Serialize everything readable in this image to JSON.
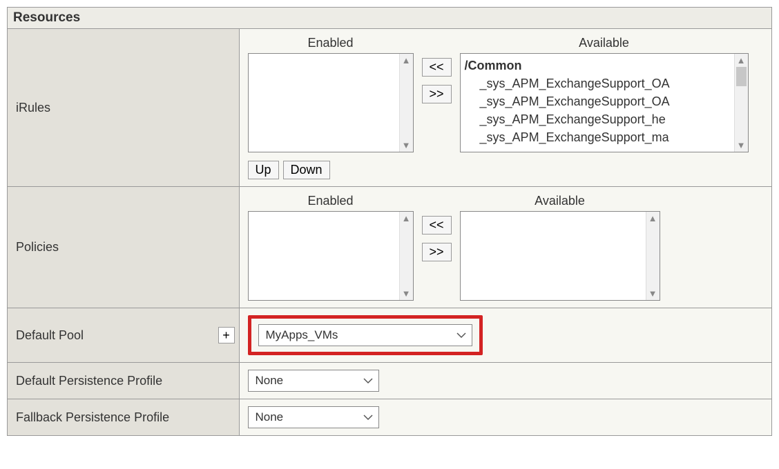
{
  "section_title": "Resources",
  "rows": {
    "irules": {
      "label": "iRules",
      "enabled_label": "Enabled",
      "available_label": "Available",
      "available_group": "/Common",
      "available_items": [
        "_sys_APM_ExchangeSupport_OA",
        "_sys_APM_ExchangeSupport_OA",
        "_sys_APM_ExchangeSupport_he",
        "_sys_APM_ExchangeSupport_ma"
      ],
      "move_left": "<<",
      "move_right": ">>",
      "up_label": "Up",
      "down_label": "Down"
    },
    "policies": {
      "label": "Policies",
      "enabled_label": "Enabled",
      "available_label": "Available",
      "move_left": "<<",
      "move_right": ">>"
    },
    "default_pool": {
      "label": "Default Pool",
      "plus": "+",
      "value": "MyApps_VMs"
    },
    "default_persistence": {
      "label": "Default Persistence Profile",
      "value": "None"
    },
    "fallback_persistence": {
      "label": "Fallback Persistence Profile",
      "value": "None"
    }
  }
}
